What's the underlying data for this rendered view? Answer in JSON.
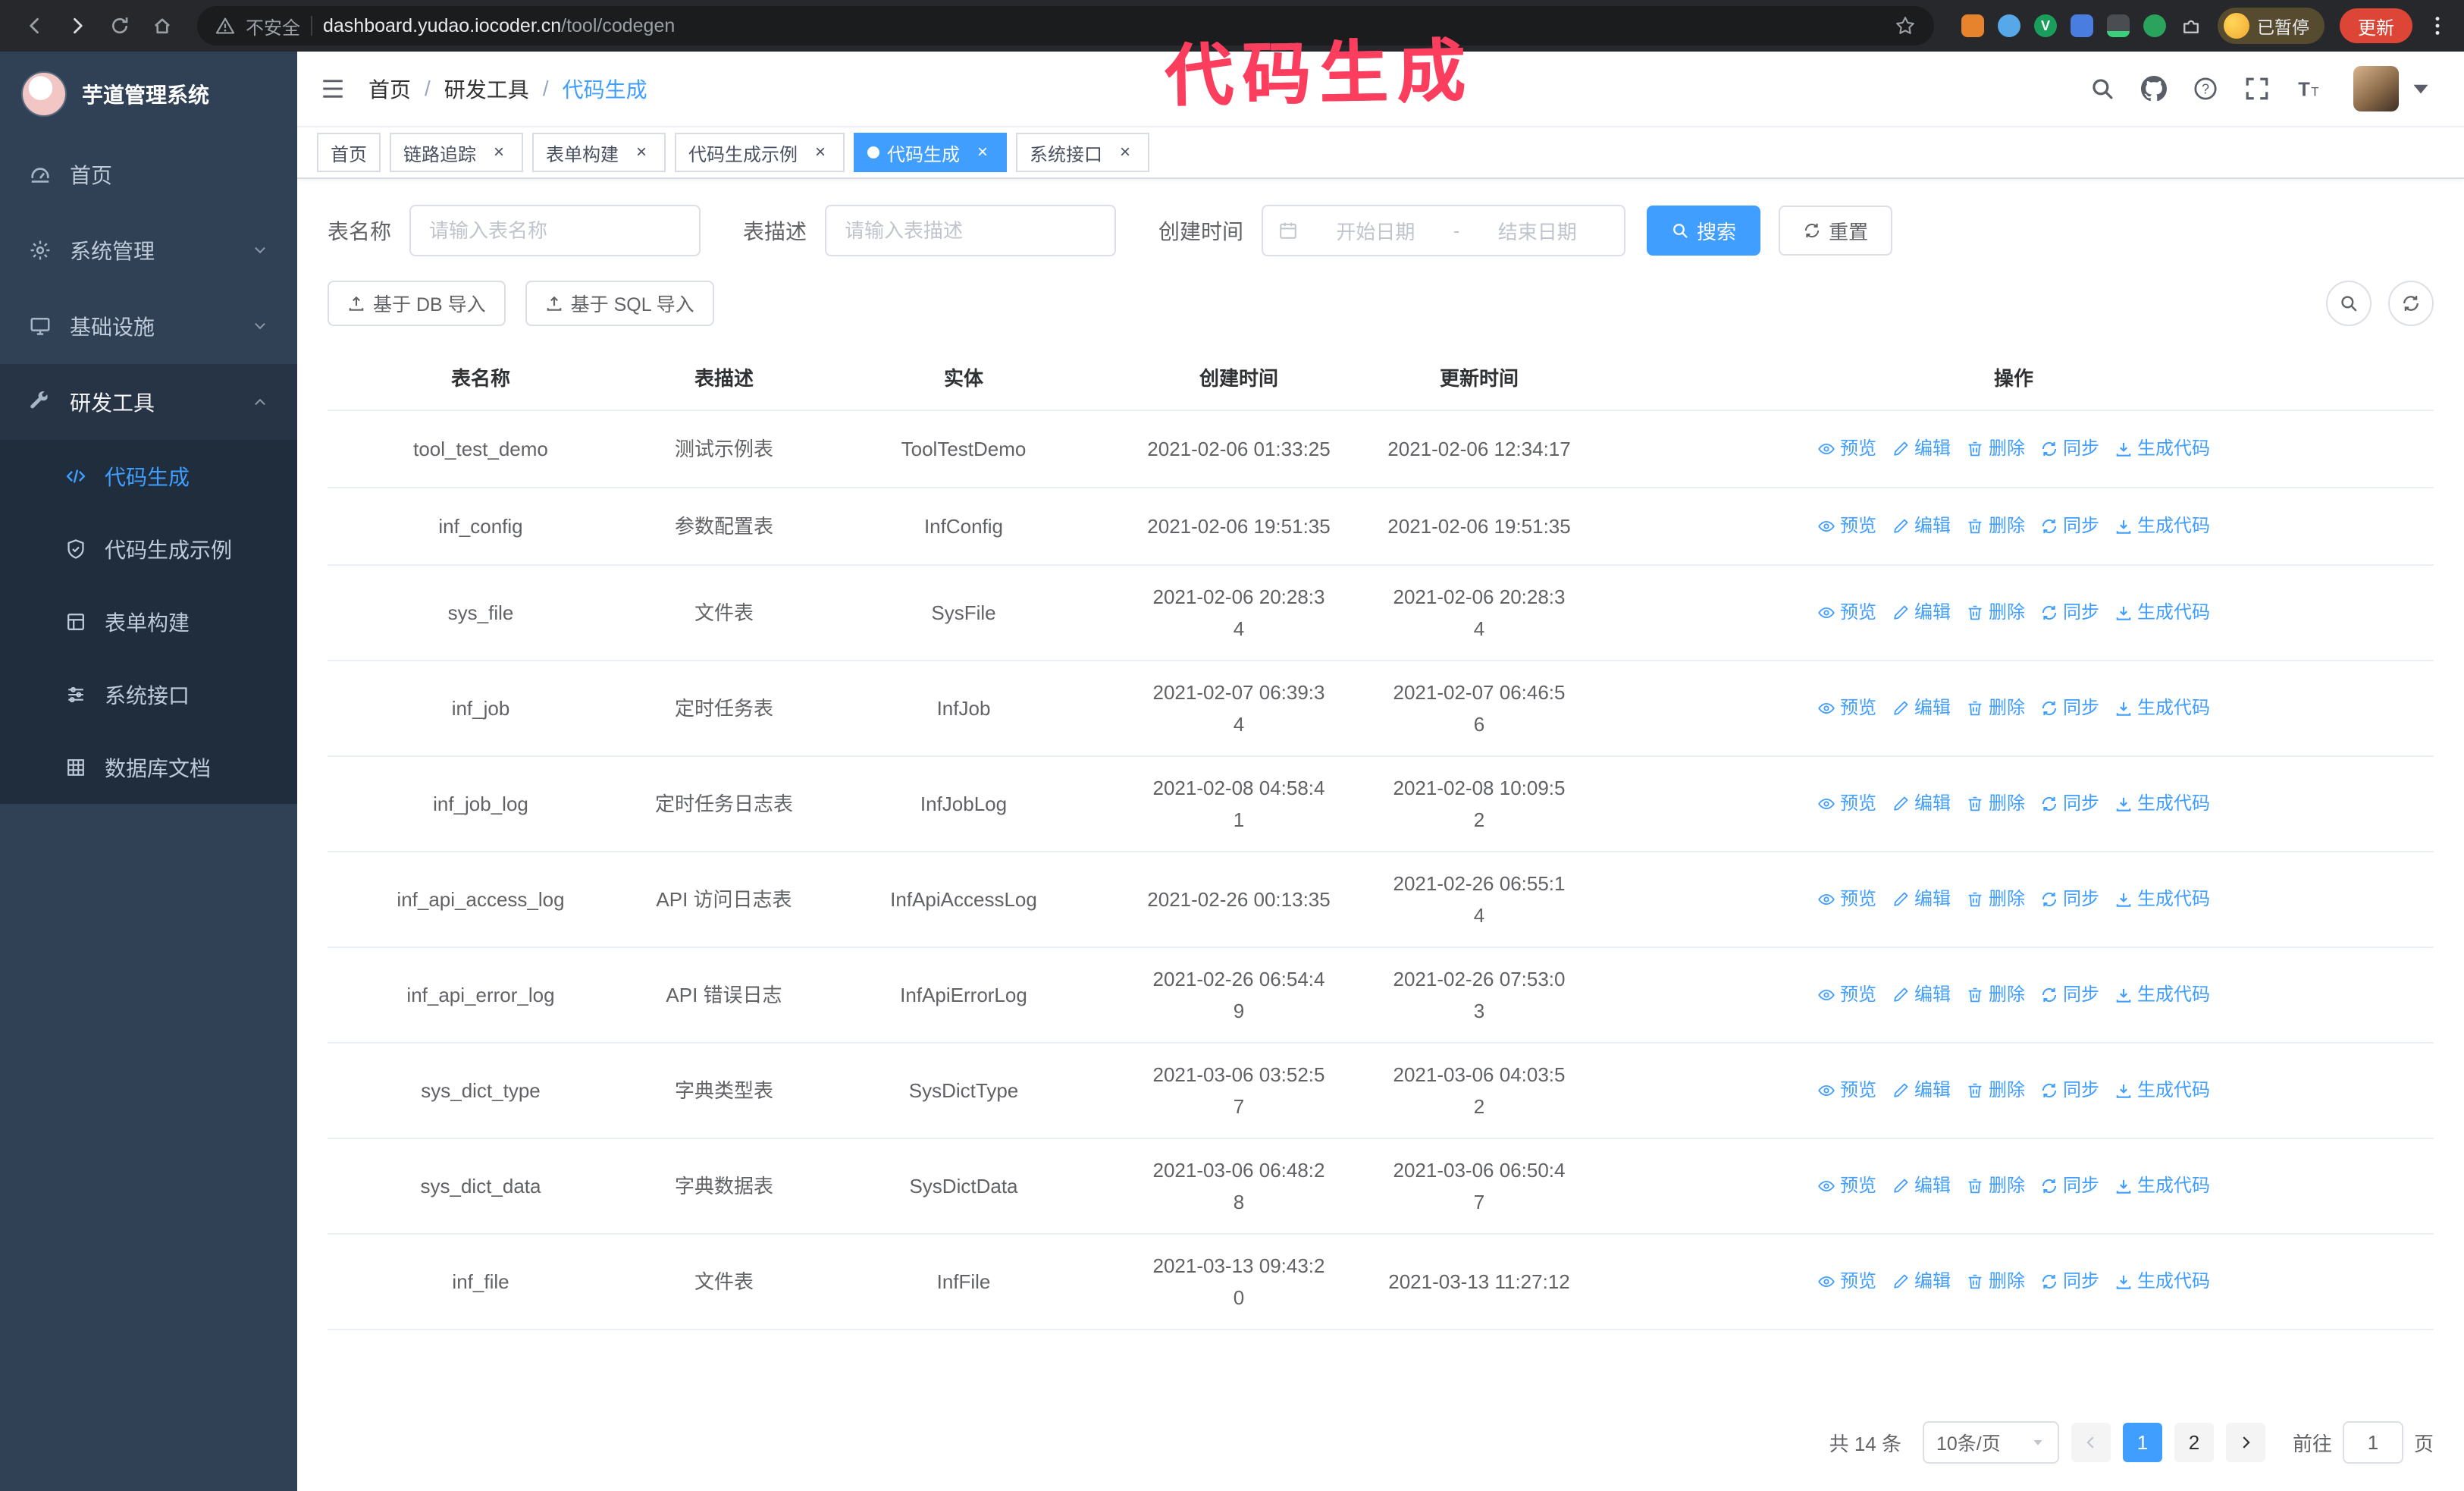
{
  "colors": {
    "primary": "#409eff",
    "sidebar_bg": "#304156",
    "submenu_bg": "#1f2d3d",
    "annotation": "#fb3e5e",
    "update_chip": "#dd4636"
  },
  "annotation": {
    "text": "代码生成"
  },
  "browser": {
    "security_label": "不安全",
    "url_domain": "dashboard.yudao.iocoder.cn",
    "url_path": "/tool/codegen",
    "paused_label": "已暂停",
    "update_label": "更新",
    "ext_badge": "V"
  },
  "sidebar": {
    "title": "芋道管理系统",
    "menu": [
      {
        "label": "首页",
        "icon": "gauge"
      },
      {
        "label": "系统管理",
        "icon": "gear",
        "chevron": "down"
      },
      {
        "label": "基础设施",
        "icon": "monitor",
        "chevron": "down"
      },
      {
        "label": "研发工具",
        "icon": "wrench",
        "chevron": "up",
        "open": true,
        "children": [
          {
            "label": "代码生成",
            "icon": "code",
            "active": true
          },
          {
            "label": "代码生成示例",
            "icon": "shield"
          },
          {
            "label": "表单构建",
            "icon": "form"
          },
          {
            "label": "系统接口",
            "icon": "api"
          },
          {
            "label": "数据库文档",
            "icon": "grid"
          }
        ]
      }
    ]
  },
  "header": {
    "breadcrumb": [
      "首页",
      "研发工具",
      "代码生成"
    ]
  },
  "tabs": [
    {
      "label": "首页",
      "closable": false,
      "active": false
    },
    {
      "label": "链路追踪",
      "closable": true,
      "active": false
    },
    {
      "label": "表单构建",
      "closable": true,
      "active": false
    },
    {
      "label": "代码生成示例",
      "closable": true,
      "active": false
    },
    {
      "label": "代码生成",
      "closable": true,
      "active": true
    },
    {
      "label": "系统接口",
      "closable": true,
      "active": false
    }
  ],
  "filters": {
    "name_label": "表名称",
    "name_placeholder": "请输入表名称",
    "desc_label": "表描述",
    "desc_placeholder": "请输入表描述",
    "time_label": "创建时间",
    "date_start": "开始日期",
    "date_separator": "-",
    "date_end": "结束日期",
    "search_label": "搜索",
    "reset_label": "重置"
  },
  "toolbar": {
    "import_db": "基于 DB 导入",
    "import_sql": "基于 SQL 导入"
  },
  "table": {
    "columns": [
      "表名称",
      "表描述",
      "实体",
      "创建时间",
      "更新时间",
      "操作"
    ],
    "actions": [
      {
        "label": "预览",
        "icon": "eye"
      },
      {
        "label": "编辑",
        "icon": "edit"
      },
      {
        "label": "删除",
        "icon": "delete"
      },
      {
        "label": "同步",
        "icon": "refresh"
      },
      {
        "label": "生成代码",
        "icon": "download"
      }
    ],
    "rows": [
      {
        "name": "tool_test_demo",
        "desc": "测试示例表",
        "entity": "ToolTestDemo",
        "created": "2021-02-06 01:33:25",
        "updated": "2021-02-06 12:34:17"
      },
      {
        "name": "inf_config",
        "desc": "参数配置表",
        "entity": "InfConfig",
        "created": "2021-02-06 19:51:35",
        "updated": "2021-02-06 19:51:35"
      },
      {
        "name": "sys_file",
        "desc": "文件表",
        "entity": "SysFile",
        "created": "2021-02-06 20:28:3\n4",
        "updated": "2021-02-06 20:28:3\n4"
      },
      {
        "name": "inf_job",
        "desc": "定时任务表",
        "entity": "InfJob",
        "created": "2021-02-07 06:39:3\n4",
        "updated": "2021-02-07 06:46:5\n6"
      },
      {
        "name": "inf_job_log",
        "desc": "定时任务日志表",
        "entity": "InfJobLog",
        "created": "2021-02-08 04:58:4\n1",
        "updated": "2021-02-08 10:09:5\n2"
      },
      {
        "name": "inf_api_access_log",
        "desc": "API 访问日志表",
        "entity": "InfApiAccessLog",
        "created": "2021-02-26 00:13:35",
        "updated": "2021-02-26 06:55:1\n4"
      },
      {
        "name": "inf_api_error_log",
        "desc": "API 错误日志",
        "entity": "InfApiErrorLog",
        "created": "2021-02-26 06:54:4\n9",
        "updated": "2021-02-26 07:53:0\n3"
      },
      {
        "name": "sys_dict_type",
        "desc": "字典类型表",
        "entity": "SysDictType",
        "created": "2021-03-06 03:52:5\n7",
        "updated": "2021-03-06 04:03:5\n2"
      },
      {
        "name": "sys_dict_data",
        "desc": "字典数据表",
        "entity": "SysDictData",
        "created": "2021-03-06 06:48:2\n8",
        "updated": "2021-03-06 06:50:4\n7"
      },
      {
        "name": "inf_file",
        "desc": "文件表",
        "entity": "InfFile",
        "created": "2021-03-13 09:43:2\n0",
        "updated": "2021-03-13 11:27:12"
      }
    ]
  },
  "pagination": {
    "total": "共 14 条",
    "page_size": "10条/页",
    "pages": [
      "1",
      "2"
    ],
    "active_page": "1",
    "goto_label": "前往",
    "goto_value": "1",
    "goto_suffix": "页"
  }
}
